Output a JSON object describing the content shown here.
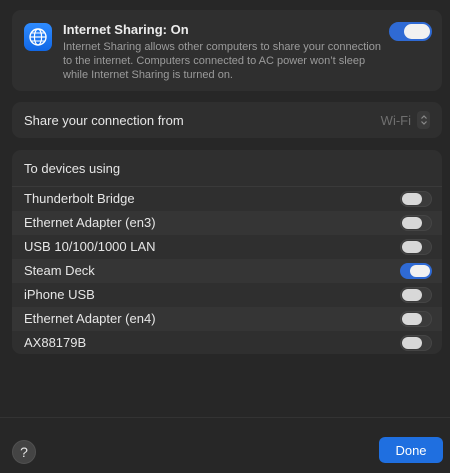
{
  "header": {
    "title": "Internet Sharing: On",
    "description": "Internet Sharing allows other computers to share your connection to the internet. Computers connected to AC power won’t sleep while Internet Sharing is turned on.",
    "enabled": true,
    "icon": "globe-icon",
    "accent_color": "#1f6fe0"
  },
  "share_from": {
    "label": "Share your connection from",
    "value": "Wi-Fi"
  },
  "devices": {
    "title": "To devices using",
    "items": [
      {
        "label": "Thunderbolt Bridge",
        "enabled": false
      },
      {
        "label": "Ethernet Adapter (en3)",
        "enabled": false
      },
      {
        "label": "USB 10/100/1000 LAN",
        "enabled": false
      },
      {
        "label": "Steam Deck",
        "enabled": true
      },
      {
        "label": "iPhone USB",
        "enabled": false
      },
      {
        "label": "Ethernet Adapter (en4)",
        "enabled": false
      },
      {
        "label": "AX88179B",
        "enabled": false
      }
    ]
  },
  "footer": {
    "help_label": "?",
    "done_label": "Done"
  }
}
